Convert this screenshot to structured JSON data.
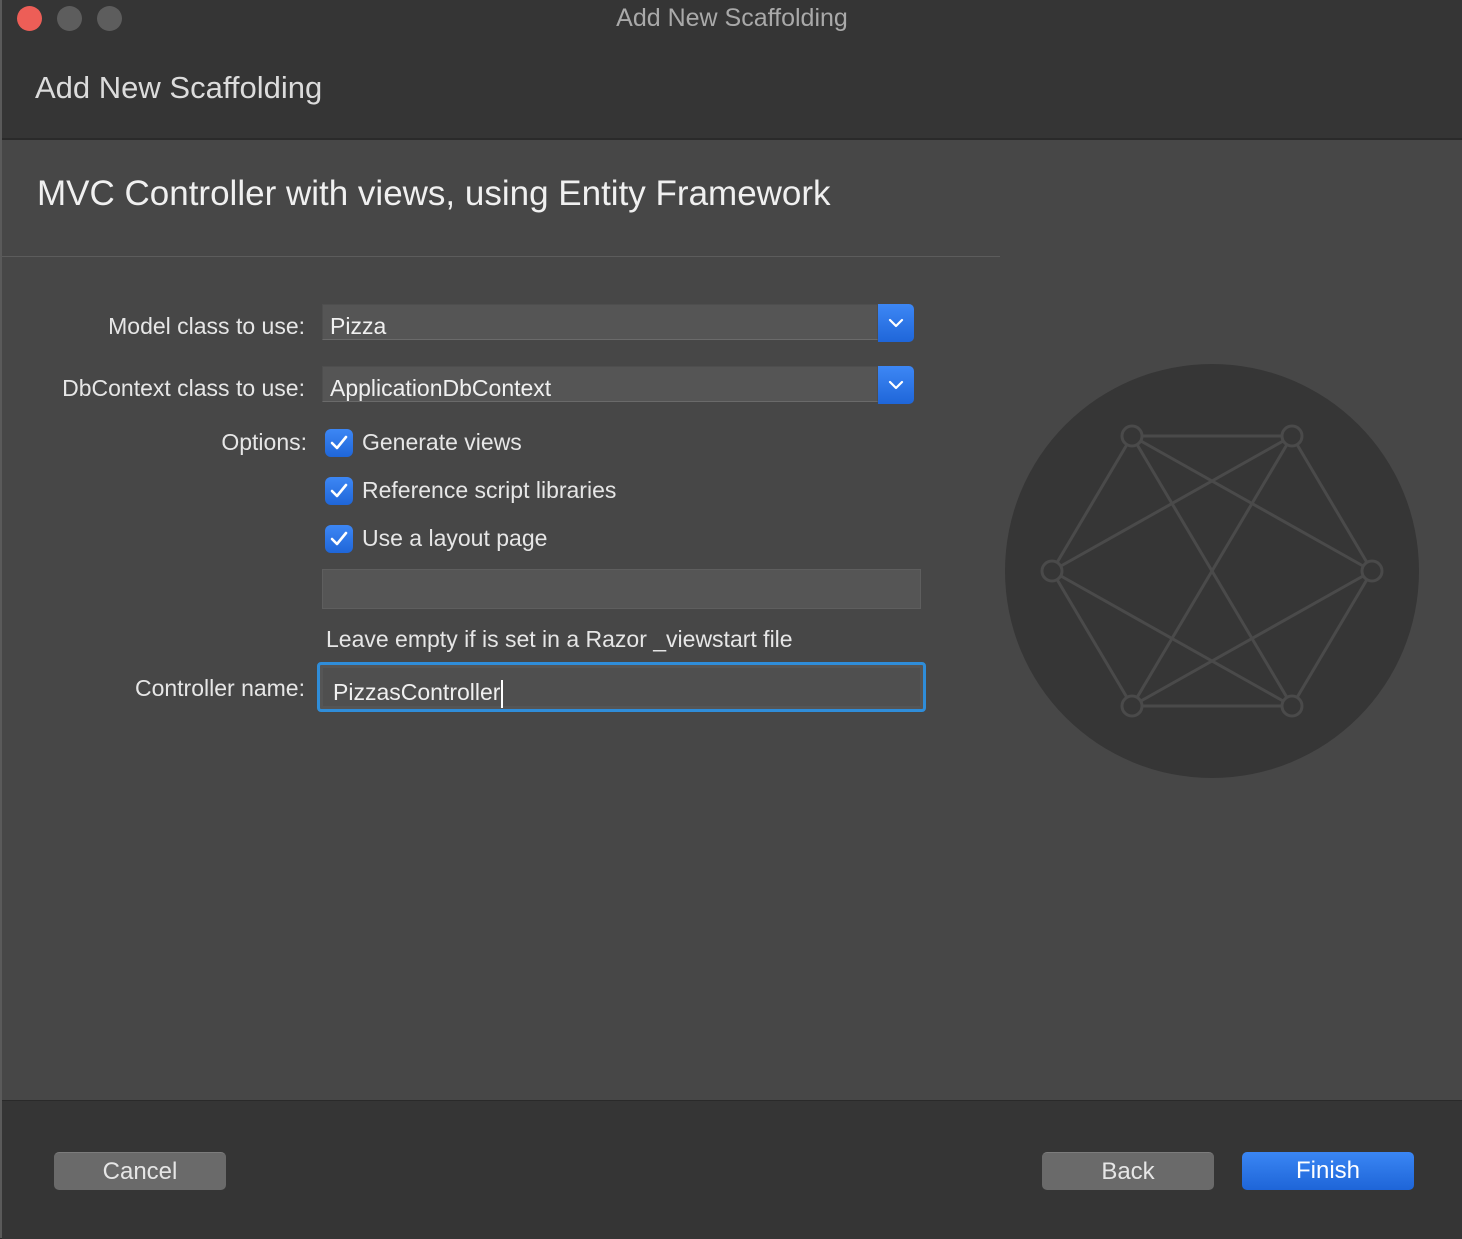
{
  "window": {
    "title": "Add New Scaffolding"
  },
  "header": {
    "title": "Add New Scaffolding"
  },
  "section": {
    "title": "MVC Controller with views, using Entity Framework"
  },
  "form": {
    "model_class": {
      "label": "Model class to use:",
      "value": "Pizza"
    },
    "dbcontext_class": {
      "label": "DbContext class to use:",
      "value": "ApplicationDbContext"
    },
    "options": {
      "label": "Options:",
      "items": [
        {
          "label": "Generate views",
          "checked": true
        },
        {
          "label": "Reference script libraries",
          "checked": true
        },
        {
          "label": "Use a layout page",
          "checked": true
        }
      ]
    },
    "layout_page": {
      "value": "",
      "hint": "Leave empty if is set in a Razor _viewstart file"
    },
    "controller_name": {
      "label": "Controller name:",
      "value": "PizzasController"
    }
  },
  "footer": {
    "cancel_label": "Cancel",
    "back_label": "Back",
    "finish_label": "Finish"
  },
  "colors": {
    "accent": "#2f7cf0",
    "focus_ring": "#2f8dd9",
    "close_button": "#ed5e57"
  },
  "icons": {
    "dropdown": "chevron-down-icon",
    "checkbox": "checkmark-icon",
    "illustration": "scaffolding-graph-icon"
  }
}
